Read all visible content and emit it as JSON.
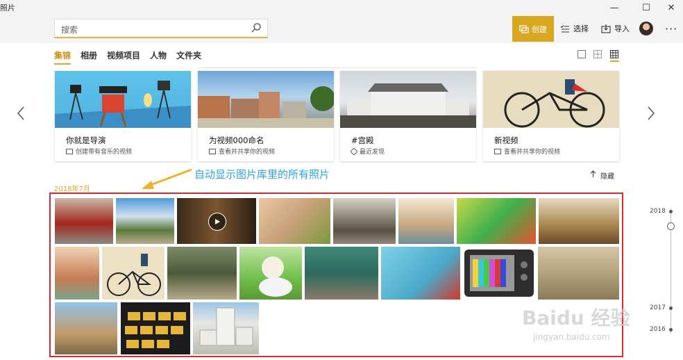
{
  "window": {
    "title": "照片",
    "minimize": "—",
    "maximize": "☐",
    "close": "✕"
  },
  "search": {
    "placeholder": "搜索"
  },
  "toolbar": {
    "create_label": "创建",
    "select_label": "选择",
    "import_label": "导入",
    "more_label": "···"
  },
  "tabs": [
    {
      "label": "集锦",
      "active": true
    },
    {
      "label": "相册",
      "active": false
    },
    {
      "label": "视频项目",
      "active": false
    },
    {
      "label": "人物",
      "active": false
    },
    {
      "label": "文件夹",
      "active": false
    }
  ],
  "cards": [
    {
      "title": "你就是导演",
      "subtitle": "创建带有音乐的视频",
      "icon": "video-icon"
    },
    {
      "title": "为视频000命名",
      "subtitle": "查看并共享你的视频",
      "icon": "video-icon"
    },
    {
      "title": "#宫殿",
      "subtitle": "最近发现",
      "icon": "tag-icon"
    },
    {
      "title": "新视频",
      "subtitle": "查看并共享你的视频",
      "icon": "video-icon"
    }
  ],
  "annotation": {
    "text": "自动显示图片库里的所有照片",
    "color": "#2aa3d8"
  },
  "collection": {
    "hide_label": "隐藏",
    "date_label": "2018年7月"
  },
  "timeline": {
    "years": [
      "2018",
      "2017",
      "2016"
    ]
  },
  "watermark": {
    "brand": "Baidu 经验",
    "url": "jingyan.baidu.com"
  },
  "colors": {
    "accent": "#d9a722",
    "highlight_border": "#d9282b",
    "annotation": "#2aa3d8"
  }
}
